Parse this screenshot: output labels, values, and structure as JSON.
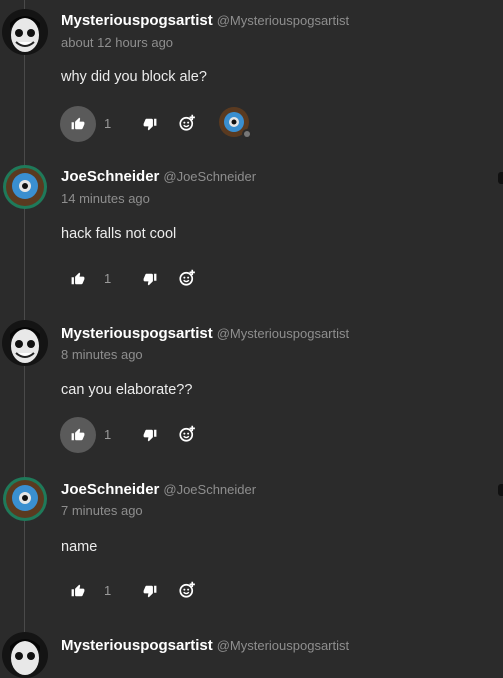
{
  "comments": [
    {
      "username": "Mysteriouspogsartist",
      "handle": "@Mysteriouspogsartist",
      "time": "about 12 hours ago",
      "text": "why did you block ale?",
      "like_count": "1",
      "avatar": "pale-face-avatar"
    },
    {
      "username": "JoeSchneider",
      "handle": "@JoeSchneider",
      "time": "14 minutes ago",
      "text": "hack falls  not cool",
      "like_count": "1",
      "avatar": "blue-fish-avatar"
    },
    {
      "username": "Mysteriouspogsartist",
      "handle": "@Mysteriouspogsartist",
      "time": "8 minutes ago",
      "text": "can you elaborate??",
      "like_count": "1",
      "avatar": "pale-face-avatar"
    },
    {
      "username": "JoeSchneider",
      "handle": "@JoeSchneider",
      "time": "7 minutes ago",
      "text": "name",
      "like_count": "1",
      "avatar": "blue-fish-avatar"
    },
    {
      "username": "Mysteriouspogsartist",
      "handle": "@Mysteriouspogsartist",
      "avatar": "pale-face-avatar"
    }
  ],
  "colors": {
    "background": "#2b2b2b",
    "text": "#ececec",
    "muted": "#8e8e8e",
    "active_like_bg": "#5a5a5a",
    "avatar_frame": "#2e8b57"
  }
}
